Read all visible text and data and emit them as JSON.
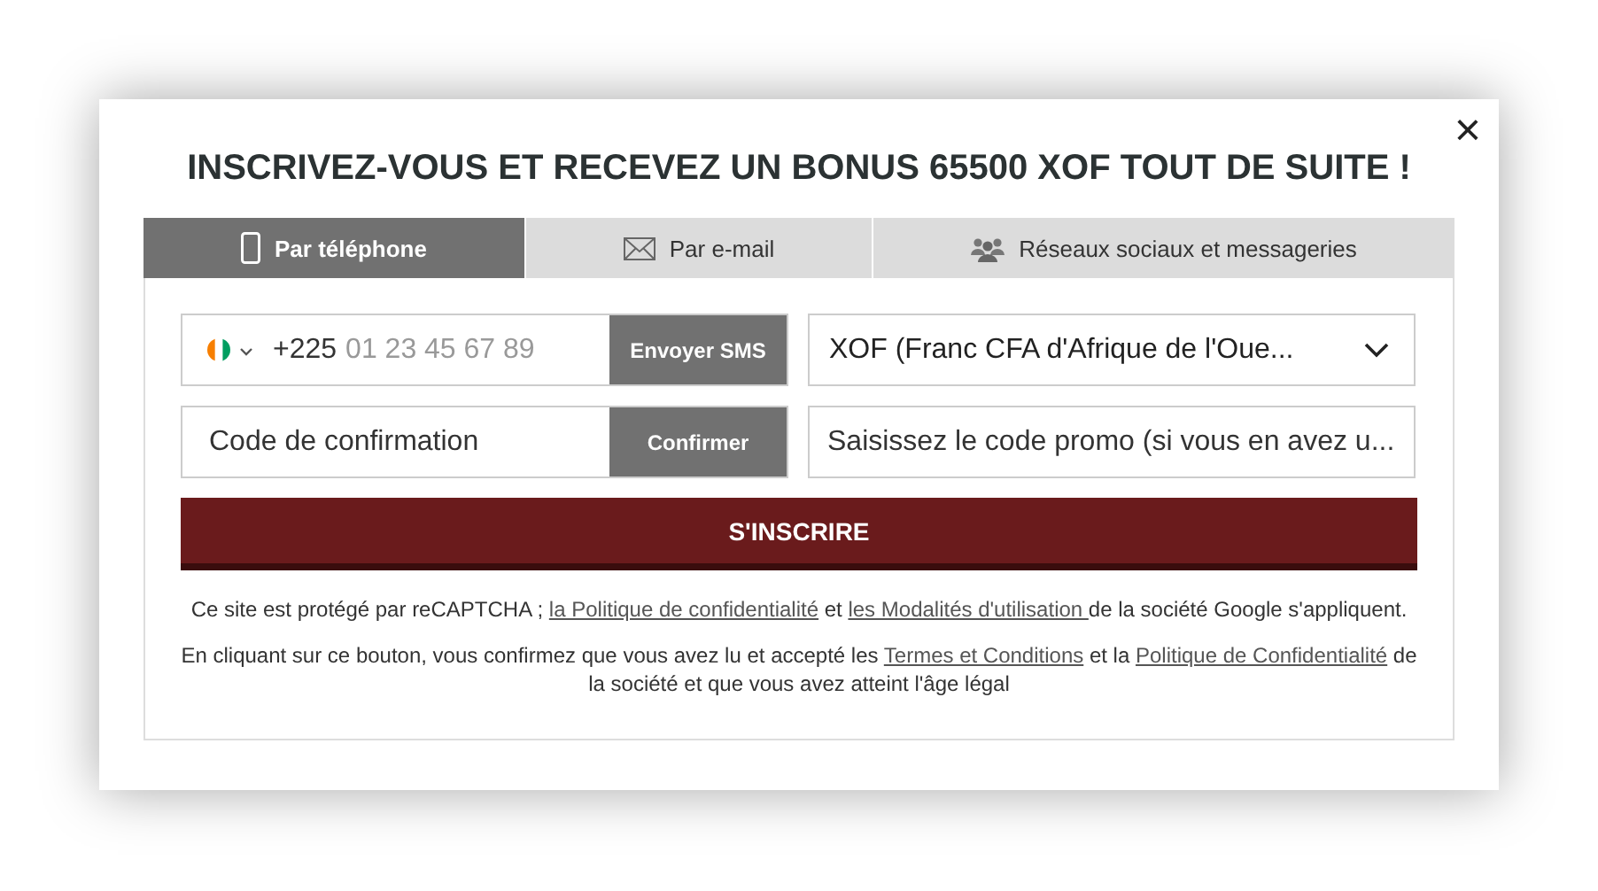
{
  "dialog": {
    "title": "INSCRIVEZ-VOUS ET RECEVEZ UN BONUS 65500 XOF TOUT DE SUITE !",
    "close": "×"
  },
  "tabs": [
    {
      "kind": "phone",
      "label": "Par téléphone",
      "selected": true
    },
    {
      "kind": "email",
      "label": "Par e-mail",
      "selected": false
    },
    {
      "kind": "social",
      "label": "Réseaux sociaux et messageries",
      "selected": false
    }
  ],
  "phone": {
    "prefix": "+225",
    "placeholder": "01 23 45 67 89",
    "button": "Envoyer SMS"
  },
  "currency": {
    "value": "XOF (Franc CFA d'Afrique de l'Oue..."
  },
  "code": {
    "placeholder": "Code de confirmation",
    "button": "Confirmer"
  },
  "promo": {
    "placeholder": "Saisissez le code promo (si vous en avez u..."
  },
  "submit": "S'INSCRIRE",
  "notes": [
    [
      {
        "kind": "text",
        "text": "Ce site est protégé par reCAPTCHA ; "
      },
      {
        "kind": "link",
        "text": "la Politique de confidentialité"
      },
      {
        "kind": "text",
        "text": " et "
      },
      {
        "kind": "link",
        "text": "les Modalités d'utilisation "
      },
      {
        "kind": "text",
        "text": "de la société Google s'appliquent."
      }
    ],
    [
      {
        "kind": "text",
        "text": "En cliquant sur ce bouton, vous confirmez que vous avez lu et accepté les "
      },
      {
        "kind": "link",
        "text": "Termes et Conditions"
      },
      {
        "kind": "text",
        "text": " et la "
      },
      {
        "kind": "link",
        "text": "Politique de Confidentialité"
      },
      {
        "kind": "text",
        "text": " de la société et que vous avez atteint l'âge légal"
      }
    ]
  ]
}
